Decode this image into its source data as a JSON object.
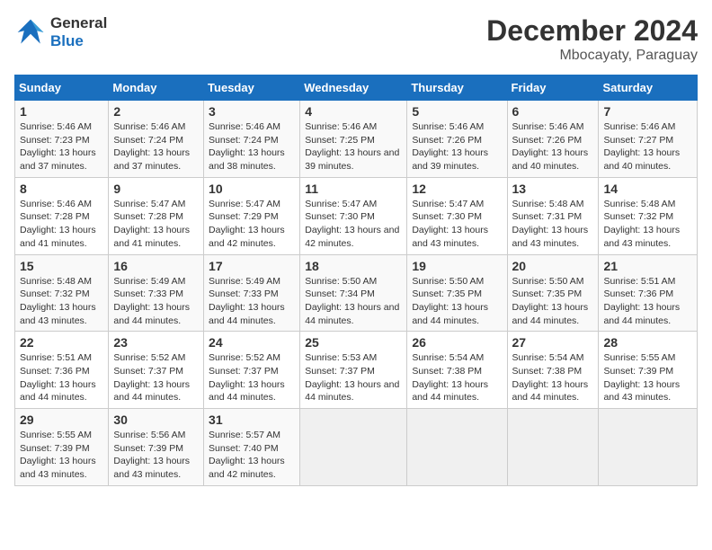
{
  "header": {
    "logo_line1": "General",
    "logo_line2": "Blue",
    "title": "December 2024",
    "subtitle": "Mbocayaty, Paraguay"
  },
  "columns": [
    "Sunday",
    "Monday",
    "Tuesday",
    "Wednesday",
    "Thursday",
    "Friday",
    "Saturday"
  ],
  "weeks": [
    [
      {
        "day": "1",
        "sunrise": "Sunrise: 5:46 AM",
        "sunset": "Sunset: 7:23 PM",
        "daylight": "Daylight: 13 hours and 37 minutes."
      },
      {
        "day": "2",
        "sunrise": "Sunrise: 5:46 AM",
        "sunset": "Sunset: 7:24 PM",
        "daylight": "Daylight: 13 hours and 37 minutes."
      },
      {
        "day": "3",
        "sunrise": "Sunrise: 5:46 AM",
        "sunset": "Sunset: 7:24 PM",
        "daylight": "Daylight: 13 hours and 38 minutes."
      },
      {
        "day": "4",
        "sunrise": "Sunrise: 5:46 AM",
        "sunset": "Sunset: 7:25 PM",
        "daylight": "Daylight: 13 hours and 39 minutes."
      },
      {
        "day": "5",
        "sunrise": "Sunrise: 5:46 AM",
        "sunset": "Sunset: 7:26 PM",
        "daylight": "Daylight: 13 hours and 39 minutes."
      },
      {
        "day": "6",
        "sunrise": "Sunrise: 5:46 AM",
        "sunset": "Sunset: 7:26 PM",
        "daylight": "Daylight: 13 hours and 40 minutes."
      },
      {
        "day": "7",
        "sunrise": "Sunrise: 5:46 AM",
        "sunset": "Sunset: 7:27 PM",
        "daylight": "Daylight: 13 hours and 40 minutes."
      }
    ],
    [
      {
        "day": "8",
        "sunrise": "Sunrise: 5:46 AM",
        "sunset": "Sunset: 7:28 PM",
        "daylight": "Daylight: 13 hours and 41 minutes."
      },
      {
        "day": "9",
        "sunrise": "Sunrise: 5:47 AM",
        "sunset": "Sunset: 7:28 PM",
        "daylight": "Daylight: 13 hours and 41 minutes."
      },
      {
        "day": "10",
        "sunrise": "Sunrise: 5:47 AM",
        "sunset": "Sunset: 7:29 PM",
        "daylight": "Daylight: 13 hours and 42 minutes."
      },
      {
        "day": "11",
        "sunrise": "Sunrise: 5:47 AM",
        "sunset": "Sunset: 7:30 PM",
        "daylight": "Daylight: 13 hours and 42 minutes."
      },
      {
        "day": "12",
        "sunrise": "Sunrise: 5:47 AM",
        "sunset": "Sunset: 7:30 PM",
        "daylight": "Daylight: 13 hours and 43 minutes."
      },
      {
        "day": "13",
        "sunrise": "Sunrise: 5:48 AM",
        "sunset": "Sunset: 7:31 PM",
        "daylight": "Daylight: 13 hours and 43 minutes."
      },
      {
        "day": "14",
        "sunrise": "Sunrise: 5:48 AM",
        "sunset": "Sunset: 7:32 PM",
        "daylight": "Daylight: 13 hours and 43 minutes."
      }
    ],
    [
      {
        "day": "15",
        "sunrise": "Sunrise: 5:48 AM",
        "sunset": "Sunset: 7:32 PM",
        "daylight": "Daylight: 13 hours and 43 minutes."
      },
      {
        "day": "16",
        "sunrise": "Sunrise: 5:49 AM",
        "sunset": "Sunset: 7:33 PM",
        "daylight": "Daylight: 13 hours and 44 minutes."
      },
      {
        "day": "17",
        "sunrise": "Sunrise: 5:49 AM",
        "sunset": "Sunset: 7:33 PM",
        "daylight": "Daylight: 13 hours and 44 minutes."
      },
      {
        "day": "18",
        "sunrise": "Sunrise: 5:50 AM",
        "sunset": "Sunset: 7:34 PM",
        "daylight": "Daylight: 13 hours and 44 minutes."
      },
      {
        "day": "19",
        "sunrise": "Sunrise: 5:50 AM",
        "sunset": "Sunset: 7:35 PM",
        "daylight": "Daylight: 13 hours and 44 minutes."
      },
      {
        "day": "20",
        "sunrise": "Sunrise: 5:50 AM",
        "sunset": "Sunset: 7:35 PM",
        "daylight": "Daylight: 13 hours and 44 minutes."
      },
      {
        "day": "21",
        "sunrise": "Sunrise: 5:51 AM",
        "sunset": "Sunset: 7:36 PM",
        "daylight": "Daylight: 13 hours and 44 minutes."
      }
    ],
    [
      {
        "day": "22",
        "sunrise": "Sunrise: 5:51 AM",
        "sunset": "Sunset: 7:36 PM",
        "daylight": "Daylight: 13 hours and 44 minutes."
      },
      {
        "day": "23",
        "sunrise": "Sunrise: 5:52 AM",
        "sunset": "Sunset: 7:37 PM",
        "daylight": "Daylight: 13 hours and 44 minutes."
      },
      {
        "day": "24",
        "sunrise": "Sunrise: 5:52 AM",
        "sunset": "Sunset: 7:37 PM",
        "daylight": "Daylight: 13 hours and 44 minutes."
      },
      {
        "day": "25",
        "sunrise": "Sunrise: 5:53 AM",
        "sunset": "Sunset: 7:37 PM",
        "daylight": "Daylight: 13 hours and 44 minutes."
      },
      {
        "day": "26",
        "sunrise": "Sunrise: 5:54 AM",
        "sunset": "Sunset: 7:38 PM",
        "daylight": "Daylight: 13 hours and 44 minutes."
      },
      {
        "day": "27",
        "sunrise": "Sunrise: 5:54 AM",
        "sunset": "Sunset: 7:38 PM",
        "daylight": "Daylight: 13 hours and 44 minutes."
      },
      {
        "day": "28",
        "sunrise": "Sunrise: 5:55 AM",
        "sunset": "Sunset: 7:39 PM",
        "daylight": "Daylight: 13 hours and 43 minutes."
      }
    ],
    [
      {
        "day": "29",
        "sunrise": "Sunrise: 5:55 AM",
        "sunset": "Sunset: 7:39 PM",
        "daylight": "Daylight: 13 hours and 43 minutes."
      },
      {
        "day": "30",
        "sunrise": "Sunrise: 5:56 AM",
        "sunset": "Sunset: 7:39 PM",
        "daylight": "Daylight: 13 hours and 43 minutes."
      },
      {
        "day": "31",
        "sunrise": "Sunrise: 5:57 AM",
        "sunset": "Sunset: 7:40 PM",
        "daylight": "Daylight: 13 hours and 42 minutes."
      },
      null,
      null,
      null,
      null
    ]
  ]
}
